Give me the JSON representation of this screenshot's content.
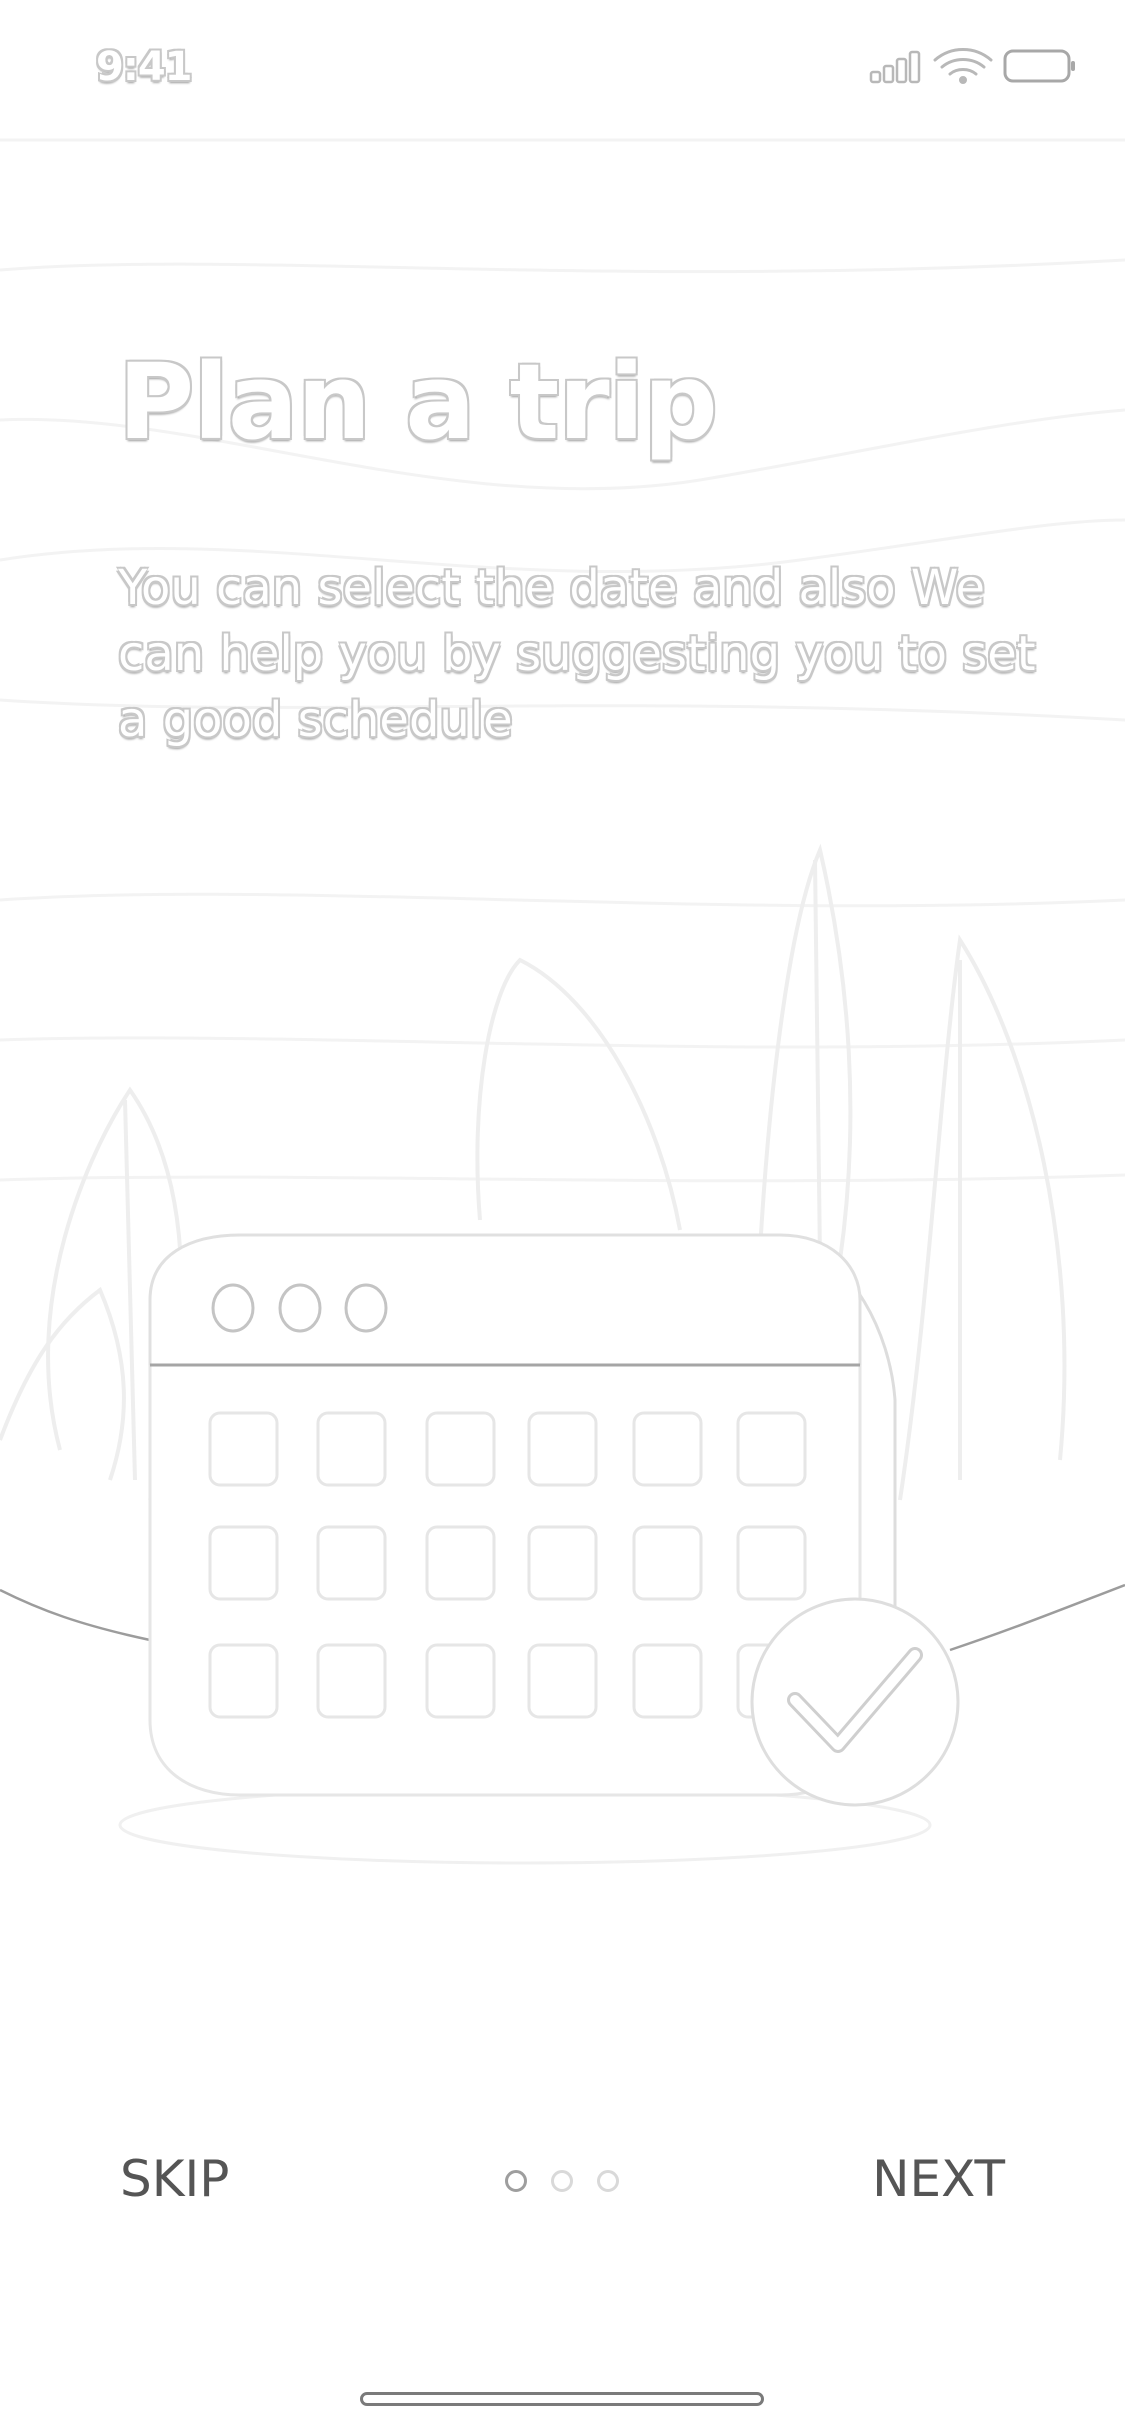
{
  "status_bar": {
    "time": "9:41",
    "icons": [
      "signal-icon",
      "wifi-icon",
      "battery-icon"
    ]
  },
  "onboarding": {
    "title": "Plan a trip",
    "description": "You can select the date and also We can help you by suggesting you to set a good schedule",
    "illustration": "calendar-with-checkmark",
    "pager": {
      "total": 3,
      "active_index": 0
    }
  },
  "footer": {
    "skip_label": "SKIP",
    "next_label": "NEXT"
  },
  "colors": {
    "background": "#ffffff",
    "outline": "#c8c8c8",
    "button_text": "#555555"
  }
}
